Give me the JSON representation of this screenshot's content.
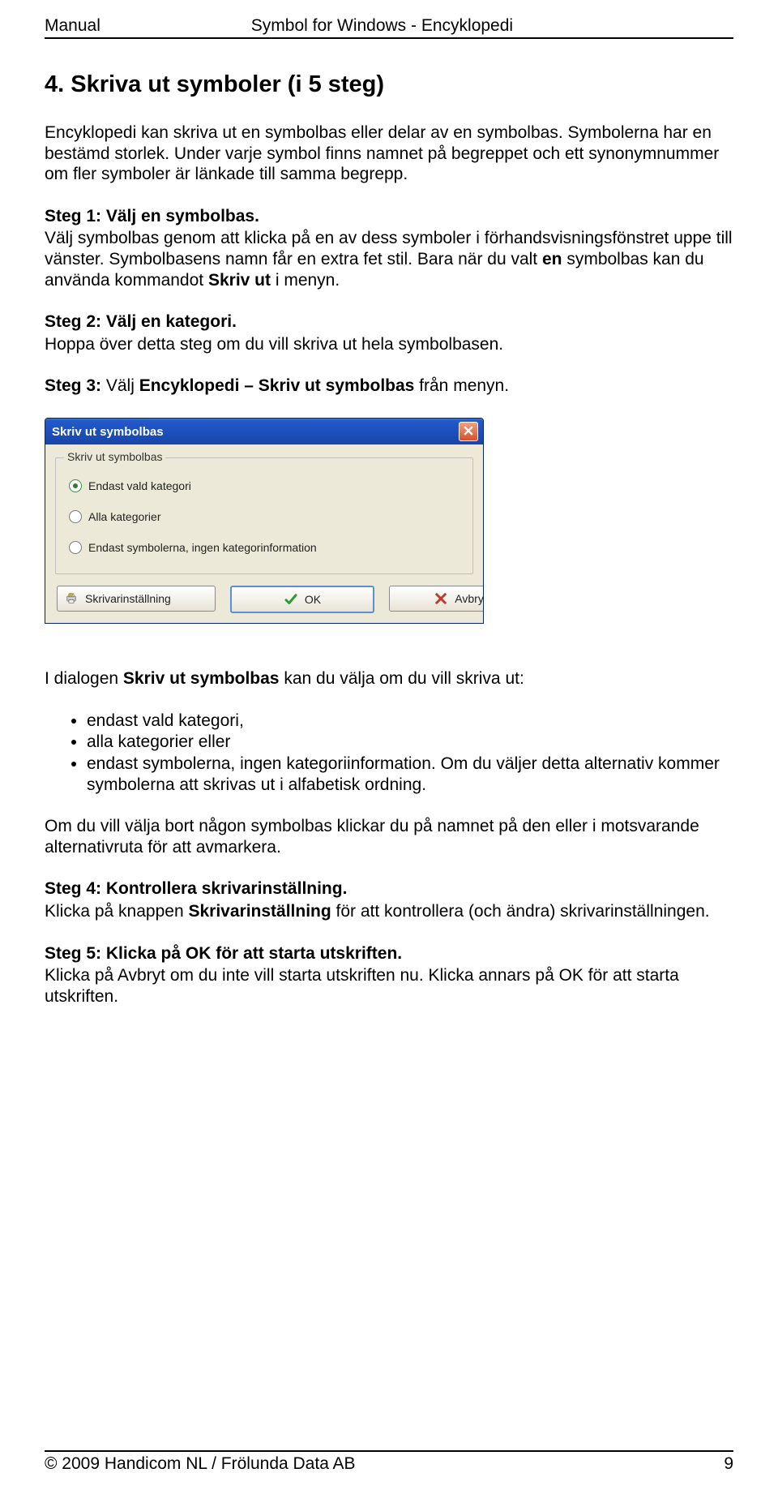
{
  "header": {
    "left": "Manual",
    "center": "Symbol for Windows - Encyklopedi"
  },
  "section_title": "4.   Skriva ut symboler (i 5 steg)",
  "intro": "Encyklopedi kan skriva ut en symbolbas eller delar av en symbolbas. Symbolerna har en bestämd storlek. Under varje symbol finns namnet på begreppet och ett synonymnummer om fler symboler är länkade till samma begrepp.",
  "step1_heading": "Steg 1: Välj en symbolbas.",
  "step1_t1": "Välj symbolbas genom att klicka på en av dess symboler i förhandsvisningsfönstret uppe till vänster. Symbolbasens namn får en extra fet stil. Bara när du valt ",
  "step1_b1": "en",
  "step1_t2": " symbolbas kan du använda kommandot ",
  "step1_b2": "Skriv ut",
  "step1_t3": " i menyn.",
  "step2_heading": "Steg 2: Välj en kategori.",
  "step2_text": "Hoppa över detta steg om du vill skriva ut hela symbolbasen.",
  "step3_t1": "Steg 3: ",
  "step3_t2": "Välj ",
  "step3_b1": "Encyklopedi – Skriv ut symbolbas",
  "step3_t3": " från menyn.",
  "dialog": {
    "title": "Skriv ut symbolbas",
    "group_legend": "Skriv ut symbolbas",
    "opt1": "Endast vald kategori",
    "opt2": "Alla kategorier",
    "opt3": "Endast symbolerna, ingen kategorinformation",
    "btn_settings": "Skrivarinställning",
    "btn_ok": "OK",
    "btn_cancel": "Avbryt"
  },
  "after_dialog_t1": "I dialogen ",
  "after_dialog_b1": "Skriv ut symbolbas",
  "after_dialog_t2": " kan du välja om du vill skriva ut:",
  "bullets": {
    "b1": "endast vald kategori,",
    "b2": "alla kategorier eller",
    "b3": "endast symbolerna, ingen kategoriinformation. Om du väljer detta alternativ kommer symbolerna att skrivas ut i alfabetisk ordning."
  },
  "deselect_text": "Om du vill välja bort någon symbolbas klickar du på namnet på den eller i motsvarande alternativruta för att avmarkera.",
  "step4_heading": "Steg 4: Kontrollera skrivarinställning.",
  "step4_t1": "Klicka på knappen ",
  "step4_b1": "Skrivarinställning",
  "step4_t2": " för att kontrollera (och ändra) skrivarinställningen.",
  "step5_heading": "Steg 5: Klicka på OK för att starta utskriften.",
  "step5_text": "Klicka på Avbryt om du inte vill starta utskriften nu. Klicka annars på OK för att starta utskriften.",
  "footer": {
    "left": "© 2009 Handicom NL / Frölunda Data AB",
    "right": "9"
  }
}
